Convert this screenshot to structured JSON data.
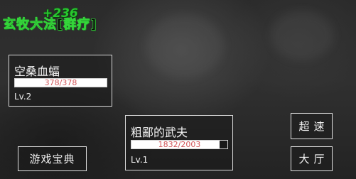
{
  "battle": {
    "skill_name": "玄牧大法[群疗]",
    "heal_popup": "+236"
  },
  "units": [
    {
      "name": "空桑血蝠",
      "hp_text": "378/378",
      "hp_fraction": 1.0,
      "level": "Lv.2"
    },
    {
      "name": "粗鄙的武夫",
      "hp_text": "1832/2003",
      "hp_fraction": 0.915,
      "level": "Lv.1"
    }
  ],
  "buttons": {
    "guide_label": "游戏宝典",
    "speed_label": "超速",
    "hall_label": "大厅"
  },
  "colors": {
    "skill_text": "#34d63a",
    "heal_text": "#27c82e",
    "hp_text": "#d2565a",
    "hp_fill": "#ffffff"
  }
}
